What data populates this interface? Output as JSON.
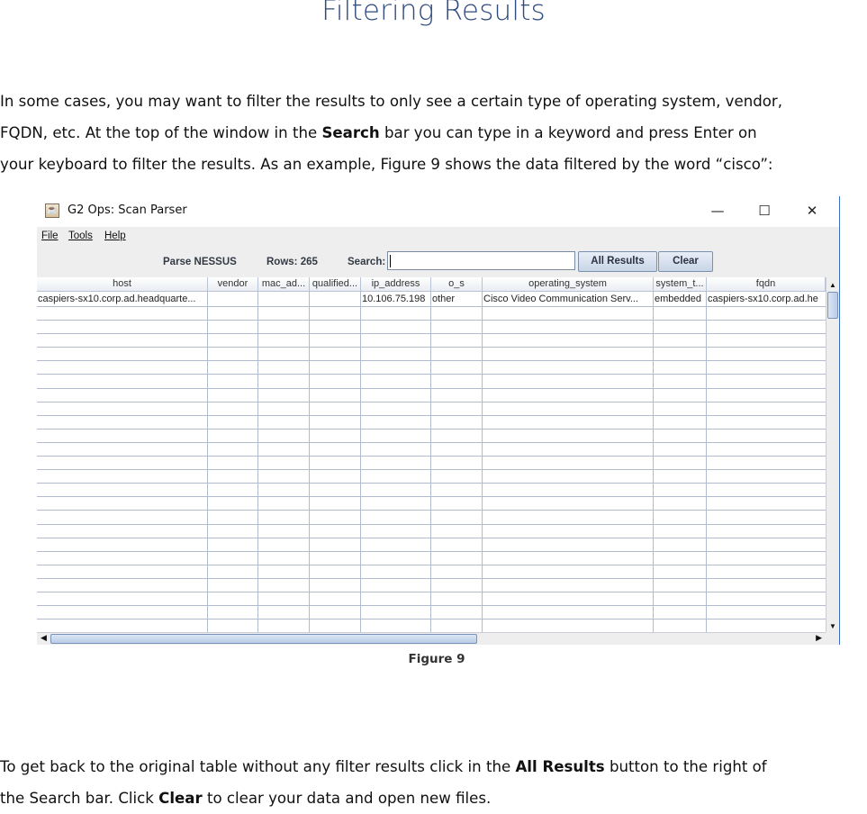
{
  "document": {
    "title": "Filtering Results",
    "intro": {
      "line1": "In some cases, you may want to filter the results to only see a certain type of operating system, vendor,",
      "line2_pre": "FQDN, etc. At the top of the window in the ",
      "line2_bold": "Search",
      "line2_post": " bar you can type in a keyword and press Enter on",
      "line3": "your keyboard to filter the results.  As an example, Figure 9 shows the data filtered by the word “cisco”:"
    },
    "caption": "Figure 9",
    "outro": {
      "line1_pre": "To get back to the original table without any filter results click in the ",
      "line1_bold": "All Results",
      "line1_post": " button to the right of",
      "line2_pre": "the Search bar. Click ",
      "line2_bold": "Clear",
      "line2_post": " to clear your data and open new files."
    }
  },
  "window": {
    "title": "G2 Ops: Scan Parser",
    "app_icon": "java-cup-icon",
    "controls": {
      "minimize": "—",
      "maximize": "☐",
      "close": "✕"
    }
  },
  "menubar": {
    "file": "File",
    "tools": "Tools",
    "help": "Help"
  },
  "toolbar": {
    "parse_label": "Parse NESSUS",
    "rows_label": "Rows: 265",
    "search_label": "Search:",
    "search_value": "",
    "all_results_label": "All Results",
    "clear_label": "Clear"
  },
  "table": {
    "columns": [
      "host",
      "vendor",
      "mac_ad...",
      "qualified...",
      "ip_address",
      "o_s",
      "operating_system",
      "system_t...",
      "fqdn"
    ],
    "rows": [
      [
        "caspiers-sx10.corp.ad.headquarte...",
        "",
        "",
        "",
        "10.106.75.198",
        "other",
        "Cisco Video Communication Serv...",
        "embedded",
        "caspiers-sx10.corp.ad.he"
      ]
    ]
  },
  "scroll": {
    "up": "▲",
    "down": "▼",
    "left": "◀",
    "right": "▶"
  }
}
